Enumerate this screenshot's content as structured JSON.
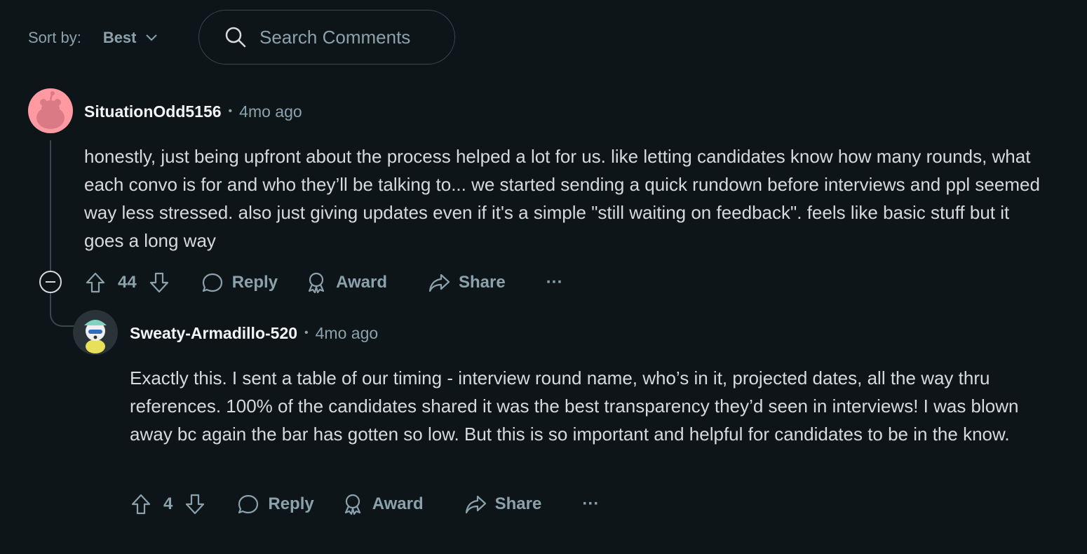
{
  "sort": {
    "label": "Sort by:",
    "value": "Best"
  },
  "search": {
    "placeholder": "Search Comments"
  },
  "comments": [
    {
      "author": "SituationOdd5156",
      "time": "4mo ago",
      "body": "honestly, just being upfront about the process helped a lot for us. like letting candidates know how many rounds, what each convo is for and who they’ll be talking to... we started sending a quick rundown before interviews and ppl seemed way less stressed. also just giving updates even if it's a simple \"still waiting on feedback\". feels like basic stuff but it goes a long way",
      "votes": "44",
      "reply_label": "Reply",
      "award_label": "Award",
      "share_label": "Share",
      "more_label": "···"
    },
    {
      "author": "Sweaty-Armadillo-520",
      "time": "4mo ago",
      "body": "Exactly this. I sent a table of our timing - interview round name, who’s in it, projected dates, all the way thru references. 100% of the candidates shared it was the best transparency they’d seen in interviews! I was blown away bc again the bar has gotten so low. But this is so important and helpful for candidates to be in the know.",
      "votes": "4",
      "reply_label": "Reply",
      "award_label": "Award",
      "share_label": "Share",
      "more_label": "···"
    }
  ]
}
